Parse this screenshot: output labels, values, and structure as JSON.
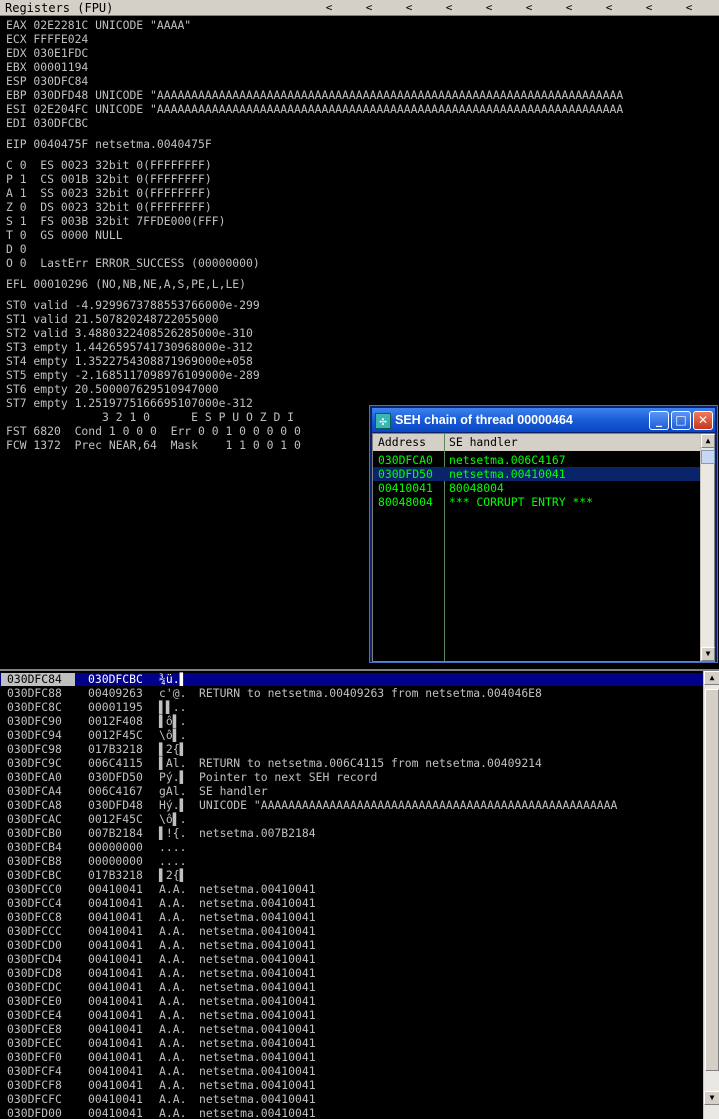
{
  "registers_pane": {
    "title": "Registers (FPU)",
    "chevron": "<",
    "lines": [
      "EAX 02E2281C UNICODE \"AAAA\"",
      "ECX FFFFE024",
      "EDX 030E1FDC",
      "EBX 00001194",
      "ESP 030DFC84",
      "EBP 030DFD48 UNICODE \"AAAAAAAAAAAAAAAAAAAAAAAAAAAAAAAAAAAAAAAAAAAAAAAAAAAAAAAAAAAAAAAAAAAA",
      "ESI 02E204FC UNICODE \"AAAAAAAAAAAAAAAAAAAAAAAAAAAAAAAAAAAAAAAAAAAAAAAAAAAAAAAAAAAAAAAAAAAA",
      "EDI 030DFCBC",
      "EIP 0040475F netsetma.0040475F",
      "C 0  ES 0023 32bit 0(FFFFFFFF)",
      "P 1  CS 001B 32bit 0(FFFFFFFF)",
      "A 1  SS 0023 32bit 0(FFFFFFFF)",
      "Z 0  DS 0023 32bit 0(FFFFFFFF)",
      "S 1  FS 003B 32bit 7FFDE000(FFF)",
      "T 0  GS 0000 NULL",
      "D 0",
      "O 0  LastErr ERROR_SUCCESS (00000000)",
      "EFL 00010296 (NO,NB,NE,A,S,PE,L,LE)",
      "ST0 valid -4.9299673788553766000e-299",
      "ST1 valid 21.507820248722055000",
      "ST2 valid 3.4880322408526285000e-310",
      "ST3 empty 1.4426595741730968000e-312",
      "ST4 empty 1.3522754308871969000e+058",
      "ST5 empty -2.1685117098976109000e-289",
      "ST6 empty 20.500007629510947000",
      "ST7 empty 1.2519775166695107000e-312",
      "              3 2 1 0      E S P U O Z D I",
      "FST 6820  Cond 1 0 0 0  Err 0 0 1 0 0 0 0 0",
      "FCW 1372  Prec NEAR,64  Mask    1 1 0 0 1 0"
    ]
  },
  "seh_window": {
    "title": "SEH chain of thread 00000464",
    "minimize_label": "_",
    "maximize_label": "□",
    "close_label": "✕",
    "icon_glyph": "✣",
    "columns": [
      "Address",
      "SE handler"
    ],
    "rows": [
      {
        "address": "030DFCA0",
        "handler": "netsetma.006C4167"
      },
      {
        "address": "030DFD50",
        "handler": "netsetma.00410041"
      },
      {
        "address": "00410041",
        "handler": "80048004"
      },
      {
        "address": "80048004",
        "handler": "*** CORRUPT ENTRY ***"
      }
    ],
    "selected_row": 1
  },
  "stack_pane": {
    "scroll_up": "▲",
    "scroll_down": "▼",
    "rows": [
      {
        "address": "030DFC84",
        "value": "030DFCBC",
        "ascii": "¾ü.▌",
        "comment": ""
      },
      {
        "address": "030DFC88",
        "value": "00409263",
        "ascii": "c'@.",
        "comment": "RETURN to netsetma.00409263 from netsetma.004046E8"
      },
      {
        "address": "030DFC8C",
        "value": "00001195",
        "ascii": "▌▌..",
        "comment": ""
      },
      {
        "address": "030DFC90",
        "value": "0012F408",
        "ascii": "▌ô▌.",
        "comment": ""
      },
      {
        "address": "030DFC94",
        "value": "0012F45C",
        "ascii": "\\ô▌.",
        "comment": ""
      },
      {
        "address": "030DFC98",
        "value": "017B3218",
        "ascii": "▌2{▌",
        "comment": ""
      },
      {
        "address": "030DFC9C",
        "value": "006C4115",
        "ascii": "▌Al.",
        "comment": "RETURN to netsetma.006C4115 from netsetma.00409214"
      },
      {
        "address": "030DFCA0",
        "value": "030DFD50",
        "ascii": "Pý.▌",
        "comment": "Pointer to next SEH record"
      },
      {
        "address": "030DFCA4",
        "value": "006C4167",
        "ascii": "gAl.",
        "comment": "SE handler"
      },
      {
        "address": "030DFCA8",
        "value": "030DFD48",
        "ascii": "Hý.▌",
        "comment": "UNICODE \"AAAAAAAAAAAAAAAAAAAAAAAAAAAAAAAAAAAAAAAAAAAAAAAAAAAA"
      },
      {
        "address": "030DFCAC",
        "value": "0012F45C",
        "ascii": "\\ô▌.",
        "comment": ""
      },
      {
        "address": "030DFCB0",
        "value": "007B2184",
        "ascii": "▌!{.",
        "comment": "netsetma.007B2184"
      },
      {
        "address": "030DFCB4",
        "value": "00000000",
        "ascii": "....",
        "comment": ""
      },
      {
        "address": "030DFCB8",
        "value": "00000000",
        "ascii": "....",
        "comment": ""
      },
      {
        "address": "030DFCBC",
        "value": "017B3218",
        "ascii": "▌2{▌",
        "comment": ""
      },
      {
        "address": "030DFCC0",
        "value": "00410041",
        "ascii": "A.A.",
        "comment": "netsetma.00410041"
      },
      {
        "address": "030DFCC4",
        "value": "00410041",
        "ascii": "A.A.",
        "comment": "netsetma.00410041"
      },
      {
        "address": "030DFCC8",
        "value": "00410041",
        "ascii": "A.A.",
        "comment": "netsetma.00410041"
      },
      {
        "address": "030DFCCC",
        "value": "00410041",
        "ascii": "A.A.",
        "comment": "netsetma.00410041"
      },
      {
        "address": "030DFCD0",
        "value": "00410041",
        "ascii": "A.A.",
        "comment": "netsetma.00410041"
      },
      {
        "address": "030DFCD4",
        "value": "00410041",
        "ascii": "A.A.",
        "comment": "netsetma.00410041"
      },
      {
        "address": "030DFCD8",
        "value": "00410041",
        "ascii": "A.A.",
        "comment": "netsetma.00410041"
      },
      {
        "address": "030DFCDC",
        "value": "00410041",
        "ascii": "A.A.",
        "comment": "netsetma.00410041"
      },
      {
        "address": "030DFCE0",
        "value": "00410041",
        "ascii": "A.A.",
        "comment": "netsetma.00410041"
      },
      {
        "address": "030DFCE4",
        "value": "00410041",
        "ascii": "A.A.",
        "comment": "netsetma.00410041"
      },
      {
        "address": "030DFCE8",
        "value": "00410041",
        "ascii": "A.A.",
        "comment": "netsetma.00410041"
      },
      {
        "address": "030DFCEC",
        "value": "00410041",
        "ascii": "A.A.",
        "comment": "netsetma.00410041"
      },
      {
        "address": "030DFCF0",
        "value": "00410041",
        "ascii": "A.A.",
        "comment": "netsetma.00410041"
      },
      {
        "address": "030DFCF4",
        "value": "00410041",
        "ascii": "A.A.",
        "comment": "netsetma.00410041"
      },
      {
        "address": "030DFCF8",
        "value": "00410041",
        "ascii": "A.A.",
        "comment": "netsetma.00410041"
      },
      {
        "address": "030DFCFC",
        "value": "00410041",
        "ascii": "A.A.",
        "comment": "netsetma.00410041"
      },
      {
        "address": "030DFD00",
        "value": "00410041",
        "ascii": "A.A.",
        "comment": "netsetma.00410041"
      }
    ]
  }
}
